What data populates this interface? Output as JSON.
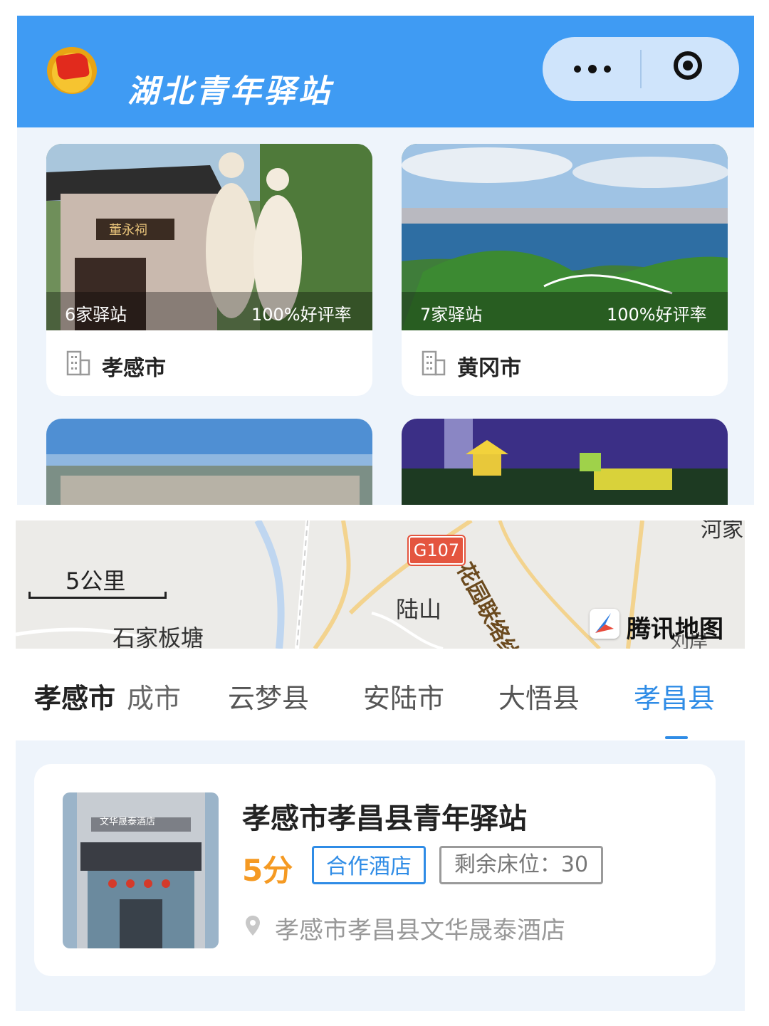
{
  "header": {
    "title": "湖北青年驿站",
    "accent_color": "#3f9bf3",
    "logo_icon": "youth-league-emblem",
    "menu_icon": "more-dots-icon",
    "close_icon": "target-close-icon"
  },
  "cities": [
    {
      "name": "孝感市",
      "stations": "6家驿站",
      "rating": "100%好评率",
      "image": "dong-yong-temple-statues"
    },
    {
      "name": "黄冈市",
      "stations": "7家驿站",
      "rating": "100%好评率",
      "image": "lake-city-aerial"
    },
    {
      "name": "",
      "stations": "",
      "rating": "",
      "image": "city-panorama"
    },
    {
      "name": "",
      "stations": "",
      "rating": "",
      "image": "night-lit-pavilion"
    }
  ],
  "map": {
    "scale": "5公里",
    "labels": {
      "place1": "石家板塘",
      "place2": "陆山",
      "road": "G107",
      "road2": "花园联络线",
      "edge1": "河家",
      "edge2": "刘岸"
    },
    "brand": "腾讯地图"
  },
  "tabs": [
    {
      "label": "孝感市",
      "active": false,
      "bold": true
    },
    {
      "label": "成市",
      "active": false
    },
    {
      "label": "云梦县",
      "active": false
    },
    {
      "label": "安陆市",
      "active": false
    },
    {
      "label": "大悟县",
      "active": false
    },
    {
      "label": "孝昌县",
      "active": true
    }
  ],
  "station": {
    "title": "孝感市孝昌县青年驿站",
    "score": "5分",
    "tag_partner": "合作酒店",
    "beds": "剩余床位：30",
    "address": "孝感市孝昌县文华晟泰酒店",
    "hotel_sign": "文华晟泰酒店",
    "score_color": "#f59a23"
  }
}
